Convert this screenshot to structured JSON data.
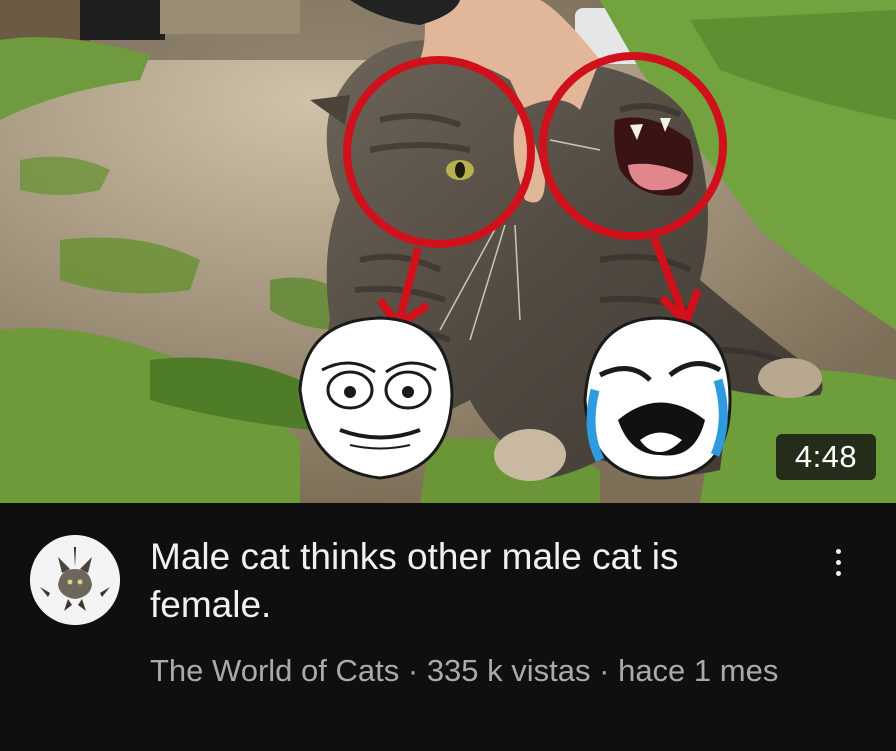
{
  "video": {
    "title": "Male cat thinks other male cat is female.",
    "duration": "4:48",
    "channel": "The World of Cats",
    "views": "335 k vistas",
    "age": "hace 1 mes",
    "separator": " · "
  },
  "icons": {
    "more": "more-vert-icon",
    "avatar": "channel-avatar"
  },
  "colors": {
    "background": "#0f0f0f",
    "title_text": "#f1f1f1",
    "meta_text": "#aaaaaa",
    "annotation_red": "#d0101a"
  }
}
